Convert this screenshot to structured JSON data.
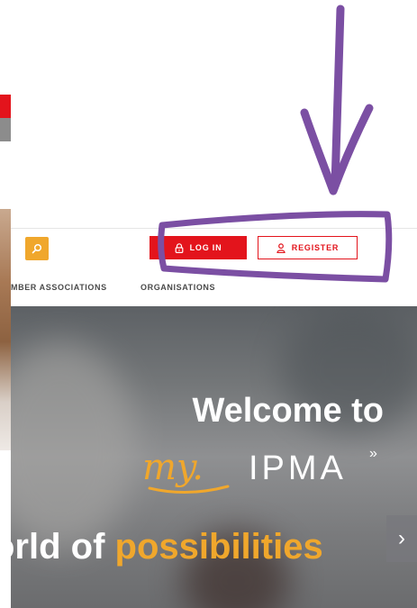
{
  "header": {
    "login_label": "LOG IN",
    "register_label": "REGISTER"
  },
  "nav": {
    "items": [
      "MBER ASSOCIATIONS",
      "ORGANISATIONS"
    ]
  },
  "hero": {
    "welcome": "Welcome to",
    "logo_script": "my.",
    "logo_brand": "IPMA",
    "tagline_pre": "orld of ",
    "tagline_highlight": "possibilities",
    "next_arrow": "›"
  },
  "colors": {
    "brand_red": "#e3141c",
    "accent_orange": "#f0a72c",
    "annotation_purple": "#7b4fa3"
  }
}
